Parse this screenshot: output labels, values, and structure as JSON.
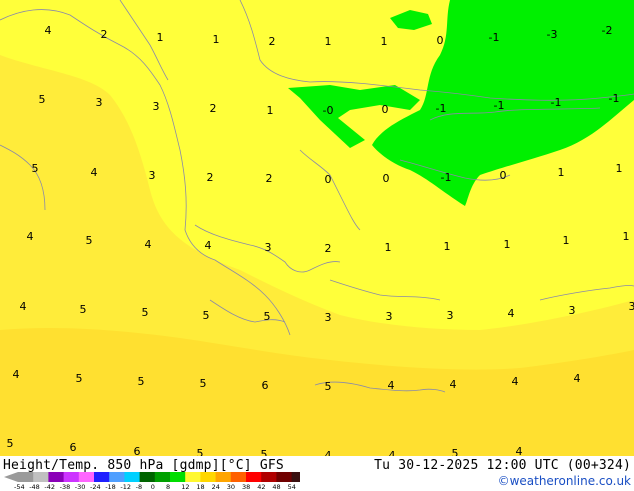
{
  "title_left": "Height/Temp. 850 hPa [gdmp][°C] GFS",
  "title_right": "Tu 30-12-2025 12:00 UTC (00+324)",
  "credit": "©weatheronline.co.uk",
  "legend": {
    "ticks": [
      "-54",
      "-48",
      "-42",
      "-38",
      "-30",
      "-24",
      "-18",
      "-12",
      "-8",
      "0",
      "8",
      "12",
      "18",
      "24",
      "30",
      "38",
      "42",
      "48",
      "54"
    ],
    "colors": [
      "#9a9a9a",
      "#c0c0c0",
      "#8a00b8",
      "#cc33ff",
      "#ff66ff",
      "#1f1fff",
      "#4f9fff",
      "#00d0ff",
      "#006400",
      "#00a000",
      "#00dd00",
      "#fff830",
      "#ffd700",
      "#ffa500",
      "#ff6000",
      "#ff0000",
      "#b00000",
      "#700000",
      "#3a1010"
    ]
  },
  "map": {
    "colors": {
      "base": "#ffff3a",
      "light": "#ffec3a",
      "warm": "#ffe030",
      "green": "#00f000",
      "border": "#8a8aa8"
    },
    "values": [
      {
        "t": "4"
      },
      {
        "t": "2"
      },
      {
        "t": "1"
      },
      {
        "t": "1"
      },
      {
        "t": "2"
      },
      {
        "t": "1"
      },
      {
        "t": "1"
      },
      {
        "t": "0"
      },
      {
        "t": "-1"
      },
      {
        "t": "-3"
      },
      {
        "t": "-2"
      },
      {
        "t": "5"
      },
      {
        "t": "3"
      },
      {
        "t": "3"
      },
      {
        "t": "2"
      },
      {
        "t": "1"
      },
      {
        "t": "-0"
      },
      {
        "t": "0"
      },
      {
        "t": "-1"
      },
      {
        "t": "-1"
      },
      {
        "t": "-1"
      },
      {
        "t": "-1"
      },
      {
        "t": "5"
      },
      {
        "t": "4"
      },
      {
        "t": "3"
      },
      {
        "t": "2"
      },
      {
        "t": "2"
      },
      {
        "t": "0"
      },
      {
        "t": "0"
      },
      {
        "t": "-1"
      },
      {
        "t": "0"
      },
      {
        "t": "1"
      },
      {
        "t": "1"
      },
      {
        "t": "4"
      },
      {
        "t": "5"
      },
      {
        "t": "4"
      },
      {
        "t": "4"
      },
      {
        "t": "3"
      },
      {
        "t": "2"
      },
      {
        "t": "1"
      },
      {
        "t": "1"
      },
      {
        "t": "1"
      },
      {
        "t": "1"
      },
      {
        "t": "1"
      },
      {
        "t": "4"
      },
      {
        "t": "5"
      },
      {
        "t": "5"
      },
      {
        "t": "5"
      },
      {
        "t": "5"
      },
      {
        "t": "3"
      },
      {
        "t": "3"
      },
      {
        "t": "3"
      },
      {
        "t": "4"
      },
      {
        "t": "3"
      },
      {
        "t": "3"
      },
      {
        "t": "4"
      },
      {
        "t": "5"
      },
      {
        "t": "5"
      },
      {
        "t": "5"
      },
      {
        "t": "6"
      },
      {
        "t": "5"
      },
      {
        "t": "4"
      },
      {
        "t": "4"
      },
      {
        "t": "4"
      },
      {
        "t": "4"
      },
      {
        "t": "5"
      },
      {
        "t": "6"
      },
      {
        "t": "6"
      },
      {
        "t": "5"
      },
      {
        "t": "5"
      },
      {
        "t": "4"
      },
      {
        "t": "4"
      },
      {
        "t": "5"
      },
      {
        "t": "4"
      }
    ]
  }
}
